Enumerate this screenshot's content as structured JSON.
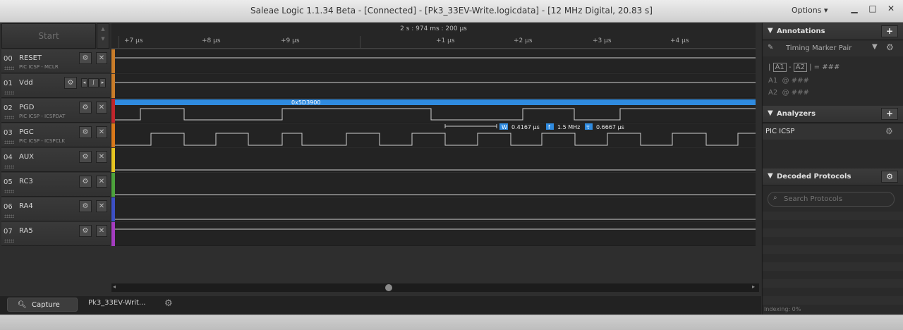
{
  "window": {
    "title": "Saleae Logic 1.1.34 Beta - [Connected] - [Pk3_33EV-Write.logicdata] - [12 MHz Digital, 20.83 s]",
    "options_label": "Options ▾"
  },
  "start_button": "Start",
  "timeline": {
    "center": "2 s : 974 ms : 200 μs",
    "ticks": [
      "+7 μs",
      "+8 μs",
      "+9 μs",
      "+1 μs",
      "+2 μs",
      "+3 μs",
      "+4 μs"
    ]
  },
  "channels": [
    {
      "num": "00",
      "name": "RESET",
      "desc": "PIC ICSP - MCLR",
      "color": "#c97c29"
    },
    {
      "num": "01",
      "name": "Vdd",
      "desc": "",
      "color": "#c97c29"
    },
    {
      "num": "02",
      "name": "PGD",
      "desc": "PIC ICSP - ICSPDAT",
      "color": "#c0262c"
    },
    {
      "num": "03",
      "name": "PGC",
      "desc": "PIC ICSP - ICSPCLK",
      "color": "#d9781a"
    },
    {
      "num": "04",
      "name": "AUX",
      "desc": "",
      "color": "#e5c421"
    },
    {
      "num": "05",
      "name": "RC3",
      "desc": "",
      "color": "#4ca23b"
    },
    {
      "num": "06",
      "name": "RA4",
      "desc": "",
      "color": "#3c4fc4"
    },
    {
      "num": "07",
      "name": "RA5",
      "desc": "",
      "color": "#a43cc0"
    }
  ],
  "decode": {
    "label": "0x5D3900",
    "bar_color": "#2f8be0"
  },
  "measure": {
    "width": "0.4167 μs",
    "freq": "1.5 MHz",
    "period": "0.6667 μs",
    "w_badge": "W",
    "f_badge": "f",
    "t_badge": "τ"
  },
  "tabs": {
    "capture": "Capture",
    "file": "Pk3_33EV-Writ..."
  },
  "annotations": {
    "title": "Annotations",
    "marker": "Timing Marker Pair",
    "formula_a1": "A1",
    "formula_a2": "A2",
    "formula_value": "= ###",
    "a1_label": "A1",
    "a1_value": "@ ###",
    "a2_label": "A2",
    "a2_value": "@ ###"
  },
  "analyzers": {
    "title": "Analyzers",
    "items": [
      "PIC ICSP"
    ]
  },
  "decoded": {
    "title": "Decoded Protocols",
    "search_placeholder": "Search Protocols"
  },
  "status": {
    "indexing": "Indexing: 0%"
  }
}
